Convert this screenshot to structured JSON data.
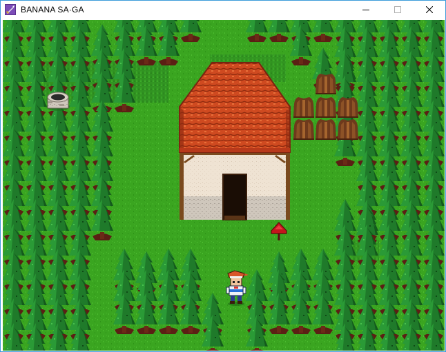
{
  "window": {
    "title": "BANANA SA·GA",
    "app_icon": "rpg-sword-icon",
    "controls": {
      "minimize": "minimize-icon",
      "maximize": "maximize-icon",
      "close": "close-icon"
    }
  },
  "scene": {
    "type": "top-down tile map",
    "objects": [
      "forest-trees",
      "stone-well",
      "house",
      "firewood-stacks",
      "red-mailbox",
      "hero"
    ],
    "colors": {
      "grass": "#3aa520",
      "tree_foliage": "#1f7a2a",
      "roof": "#cf4a20",
      "wall": "#efe3d3",
      "mailbox": "#c4141c"
    }
  }
}
